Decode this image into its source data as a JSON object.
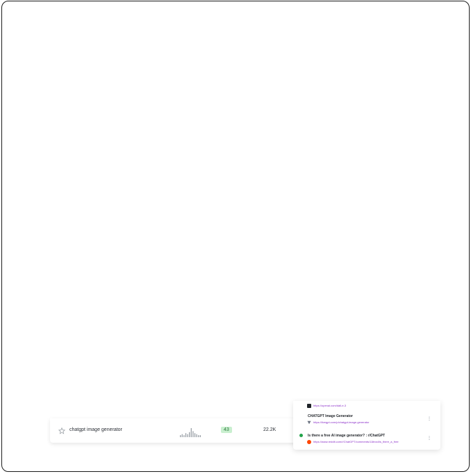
{
  "keyword_table": {
    "rows": [
      {
        "keyword": "chatgpt image generator",
        "kd": "43",
        "volume": "22.2K",
        "trend": [
          2,
          3,
          2,
          4,
          3,
          5,
          9,
          6,
          4,
          3,
          2,
          2
        ]
      }
    ]
  },
  "serp": {
    "results": [
      {
        "title": "",
        "url": "https://openai.com/dall-e-3",
        "icon": "openai-icon",
        "icon_color": "#1f2328"
      },
      {
        "title": "CHATGPT Image Generator",
        "url": "https://livegpt.com/p/chatgpt-image-generator",
        "icon": "vercel-triangle-icon",
        "icon_color": "#6b7280"
      },
      {
        "title": "Is there a free AI image generator? : r/ChatGPT",
        "url": "https://www.reddit.com/r/ChatGPT/comments/11ltnxd/is_there_a_free",
        "icon": "reddit-icon",
        "icon_color": "#ff4500"
      }
    ]
  },
  "colors": {
    "link": "#8b2fc9",
    "kd_badge_bg": "#c9efcf",
    "kd_badge_text": "#2a7a3a",
    "rank_dot": "#22a34a"
  }
}
